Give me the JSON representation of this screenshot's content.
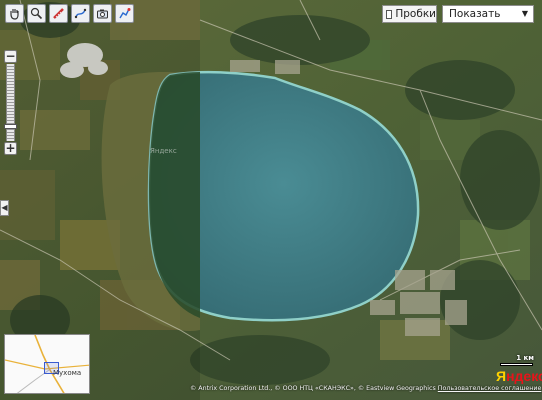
{
  "toolbar": {
    "tools": [
      {
        "name": "hand-tool",
        "icon": "hand-icon"
      },
      {
        "name": "magnifier-tool",
        "icon": "magnifier-icon"
      },
      {
        "name": "ruler-tool",
        "icon": "ruler-icon"
      },
      {
        "name": "measure-tool",
        "icon": "path-icon"
      },
      {
        "name": "print-tool",
        "icon": "camera-icon"
      },
      {
        "name": "route-tool",
        "icon": "route-icon"
      }
    ]
  },
  "traffic": {
    "label": "Пробки"
  },
  "layer_select": {
    "value": "Показать"
  },
  "map": {
    "watermark": "Яндекс",
    "minimap_label": "Мухома",
    "copyright": "© Antrix Corporation Ltd., © ООО НТЦ «СКАНЭКС», © Eastview Geographics",
    "copyright_link": "Пользовательское соглашение",
    "scale_label": "1 км",
    "logo": "Яндекс",
    "colors": {
      "water": "#3e7d86",
      "land": "#5d6b3b",
      "shore": "#8fd0c8"
    }
  }
}
